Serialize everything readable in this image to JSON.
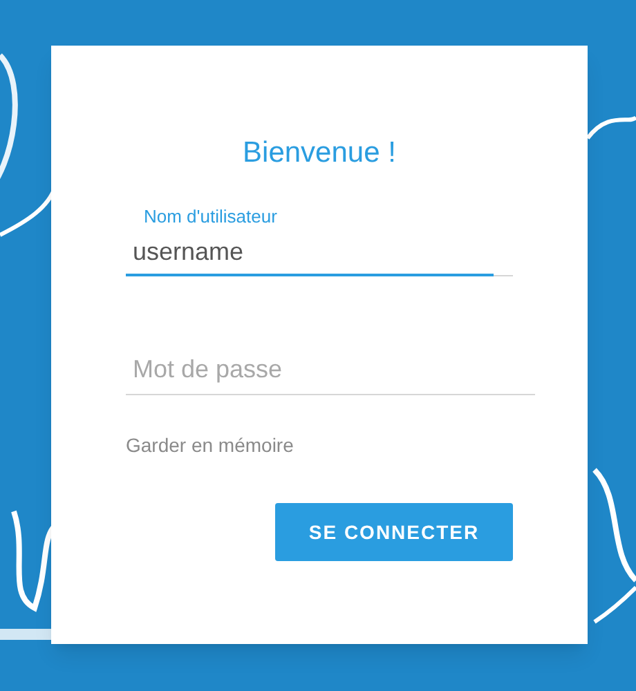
{
  "title": "Bienvenue !",
  "username": {
    "label": "Nom d'utilisateur",
    "value": "username",
    "focused": true
  },
  "password": {
    "placeholder": "Mot de passe",
    "focused": false
  },
  "remember": {
    "label": "Garder en mémoire"
  },
  "submit": {
    "label": "SE CONNECTER"
  }
}
